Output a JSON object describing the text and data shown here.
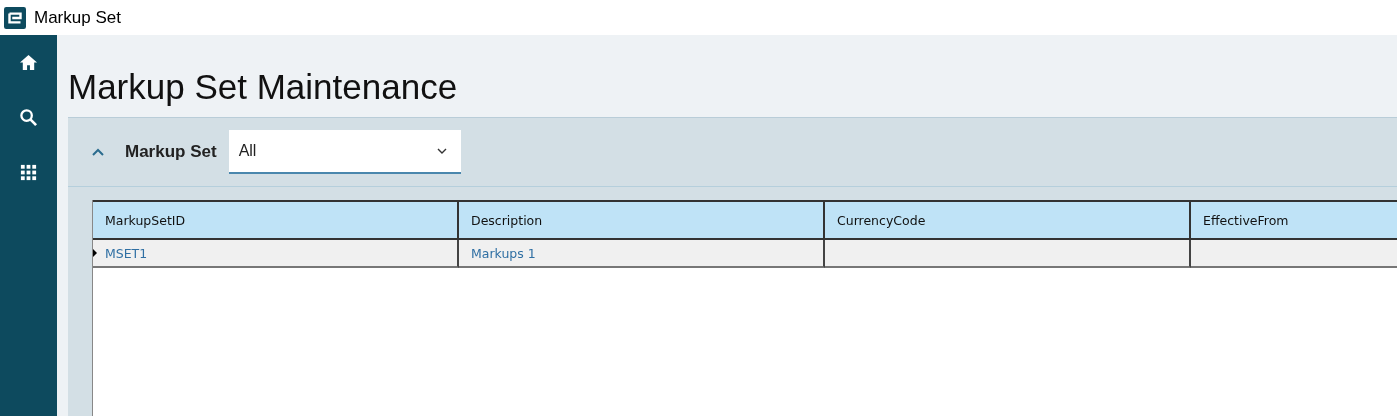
{
  "window": {
    "title": "Markup Set"
  },
  "sidebar": {
    "items": [
      {
        "kind": "home"
      },
      {
        "kind": "search"
      },
      {
        "kind": "apps"
      }
    ]
  },
  "page": {
    "title": "Markup Set Maintenance"
  },
  "filter": {
    "expanded": true,
    "label": "Markup Set",
    "value": "All"
  },
  "table": {
    "columns": [
      "MarkupSetID",
      "Description",
      "CurrencyCode",
      "EffectiveFrom"
    ],
    "rows": [
      {
        "current": true,
        "cells": [
          "MSET1",
          "Markups 1"
        ]
      }
    ]
  }
}
